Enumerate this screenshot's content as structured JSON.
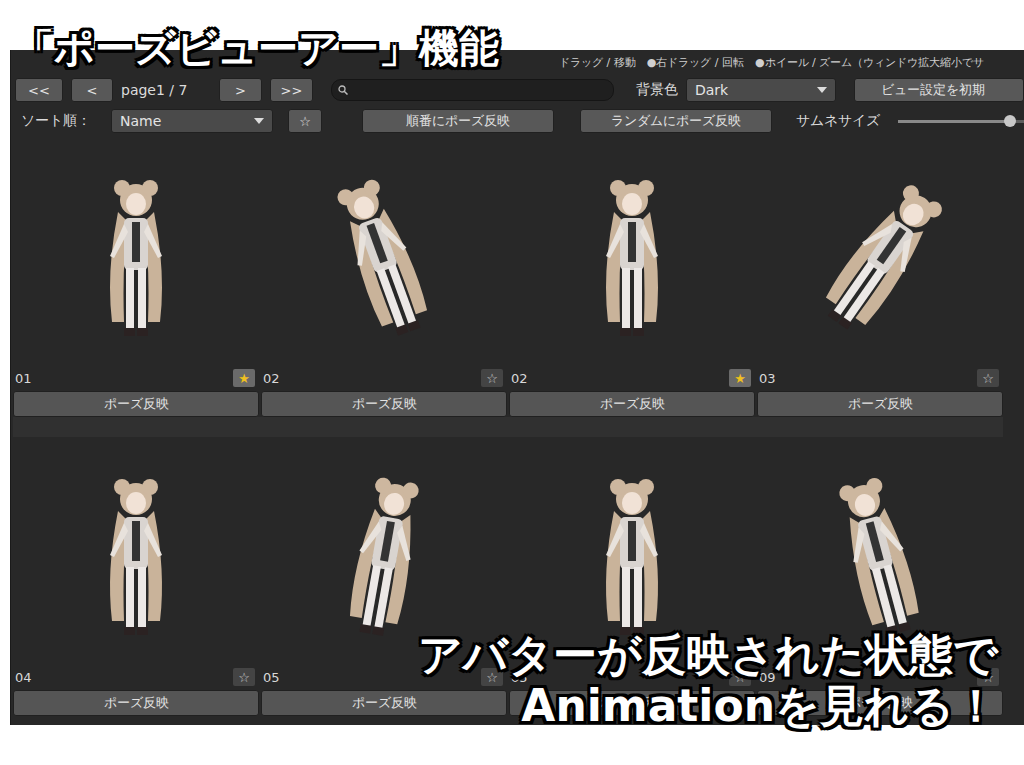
{
  "overlay": {
    "title": "「ポーズビューアー」機能",
    "caption": [
      "アバターが反映された状態で",
      "Animationを見れる！"
    ]
  },
  "toolbar": {
    "hint": "ドラッグ / 移動　●右ドラッグ / 回転　●ホイール / ズーム（ウィンドウ拡大縮小でサ",
    "nav_prev": [
      "<<",
      "<"
    ],
    "page": "page1 / 7",
    "nav_next": [
      ">",
      ">>"
    ],
    "background": {
      "label": "背景色",
      "value": "Dark"
    },
    "reset_button": "ビュー設定を初期",
    "sort": {
      "label": "ソート順：",
      "value": "Name",
      "star_filter": "☆"
    },
    "actions": [
      "順番にポーズ反映",
      "ランダムにポーズ反映"
    ],
    "thumb_size": {
      "label": "サムネサイズ",
      "level": 0.8
    }
  },
  "poses": [
    {
      "name": "01",
      "star": "★",
      "starred": true,
      "button": "ポーズ反映"
    },
    {
      "name": "02",
      "star": "☆",
      "starred": false,
      "button": "ポーズ反映"
    },
    {
      "name": "02",
      "star": "★",
      "starred": true,
      "button": "ポーズ反映"
    },
    {
      "name": "03",
      "star": "☆",
      "starred": false,
      "button": "ポーズ反映"
    },
    {
      "name": "04",
      "star": "☆",
      "starred": false,
      "button": "ポーズ反映"
    },
    {
      "name": "05",
      "star": "☆",
      "starred": false,
      "button": "ポーズ反映"
    },
    {
      "name": "05",
      "star": "☆",
      "starred": false,
      "button": "ポーズ反映"
    },
    {
      "name": "09",
      "star": "☆",
      "starred": false,
      "button": "ポーズ反映"
    }
  ]
}
